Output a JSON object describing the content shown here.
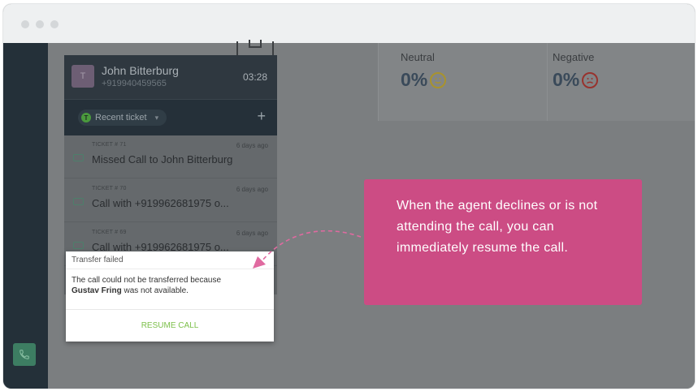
{
  "window": {
    "chrome_dots": [
      "close",
      "minimize",
      "maximize"
    ]
  },
  "sentiment": {
    "neutral_label": "Neutral",
    "neutral_value": "0%",
    "negative_label": "Negative",
    "negative_value": "0%"
  },
  "call": {
    "avatar_initial": "T",
    "caller_name": "John Bitterburg",
    "caller_number": "+919940459565",
    "timer": "03:28",
    "recent_ticket_label": "Recent ticket",
    "ticket_badge": "T",
    "add_label": "+"
  },
  "tickets": [
    {
      "number": "TICKET # 71",
      "age": "6 days ago",
      "title": "Missed Call to John Bitterburg"
    },
    {
      "number": "TICKET # 70",
      "age": "6 days ago",
      "title": "Call with +919962681975 o..."
    },
    {
      "number": "TICKET # 69",
      "age": "6 days ago",
      "title": "Call with +919962681975 o..."
    }
  ],
  "popup": {
    "title": "Transfer failed",
    "body_prefix": "The call could not be transferred because",
    "agent_name": "Gustav Fring",
    "body_suffix": "was not available.",
    "action_label": "RESUME CALL"
  },
  "callout": {
    "text": "When the agent declines or is not attending  the call, you can immediately resume the call."
  },
  "colors": {
    "callout_bg": "#cc4c84",
    "resume_green": "#7cc04a",
    "sidebar": "#243039",
    "overlay": "#7b7e80"
  }
}
